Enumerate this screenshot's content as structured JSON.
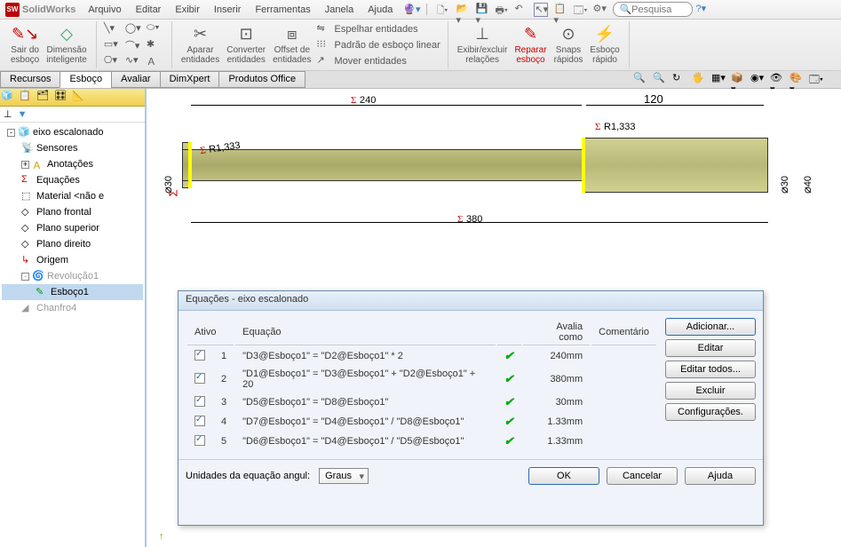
{
  "app": {
    "name": "SolidWorks"
  },
  "menubar": {
    "items": [
      "Arquivo",
      "Editar",
      "Exibir",
      "Inserir",
      "Ferramentas",
      "Janela",
      "Ajuda"
    ]
  },
  "search": {
    "placeholder": "Pesquisa"
  },
  "ribbon": {
    "exitSketch": "Sair do\nesboço",
    "smartDim": "Dimensão\ninteligente",
    "trim": "Aparar\nentidades",
    "convert": "Converter\nentidades",
    "offset": "Offset de\nentidades",
    "mirror": "Espelhar entidades",
    "pattern": "Padrão de esboço linear",
    "move": "Mover entidades",
    "relations": "Exibir/excluir\nrelações",
    "repair": "Reparar\nesboço",
    "snaps": "Snaps\nrápidos",
    "rapid": "Esboço\nrápido"
  },
  "tabs": [
    "Recursos",
    "Esboço",
    "Avaliar",
    "DimXpert",
    "Produtos Office"
  ],
  "tree": {
    "root": "eixo escalonado",
    "items": [
      "Sensores",
      "Anotações",
      "Equações",
      "Material <não e",
      "Plano frontal",
      "Plano superior",
      "Plano direito",
      "Origem",
      "Revolução1",
      "Esboço1",
      "Chanfro4"
    ]
  },
  "dims": {
    "d240": "240",
    "d120": "120",
    "d380": "380",
    "r1": "R1,333",
    "r2": "R1,333",
    "dia30a": "30",
    "dia30b": "30",
    "dia40": "40"
  },
  "dialog": {
    "title": "Equações - eixo escalonado",
    "headers": {
      "ativo": "Ativo",
      "eq": "Equação",
      "avalia": "Avalia como",
      "com": "Comentário"
    },
    "rows": [
      {
        "n": "1",
        "eq": "\"D3@Esboço1\" = \"D2@Esboço1\" * 2",
        "val": "240mm"
      },
      {
        "n": "2",
        "eq": "\"D1@Esboço1\" = \"D3@Esboço1\" + \"D2@Esboço1\" + 20",
        "val": "380mm"
      },
      {
        "n": "3",
        "eq": "\"D5@Esboço1\" = \"D8@Esboço1\"",
        "val": "30mm"
      },
      {
        "n": "4",
        "eq": "\"D7@Esboço1\" = \"D4@Esboço1\" / \"D8@Esboço1\"",
        "val": "1.33mm"
      },
      {
        "n": "5",
        "eq": "\"D6@Esboço1\" = \"D4@Esboço1\" / \"D5@Esboço1\"",
        "val": "1.33mm"
      }
    ],
    "buttons": {
      "add": "Adicionar...",
      "edit": "Editar",
      "editAll": "Editar todos...",
      "del": "Excluir",
      "cfg": "Configurações."
    },
    "unitsLabel": "Unidades da equação angul:",
    "unitsValue": "Graus",
    "ok": "OK",
    "cancel": "Cancelar",
    "help": "Ajuda"
  }
}
